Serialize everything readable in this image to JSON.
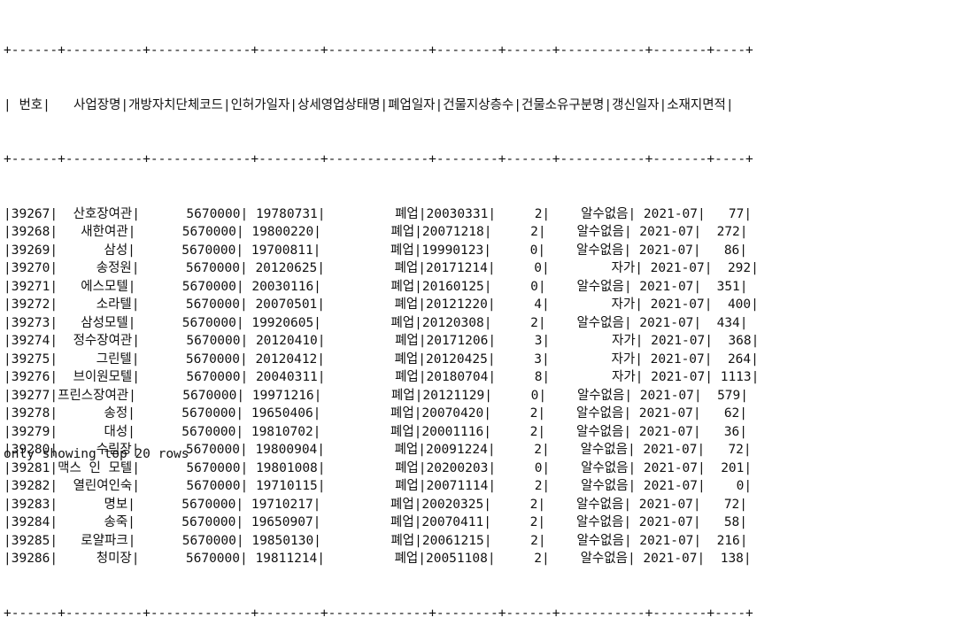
{
  "table": {
    "border": "+------+----------+-------------+--------+-------------+--------+------+-----------+-------+----+",
    "header": "| 번호|   사업장명|개방자치단체코드|인허가일자|상세영업상태명|폐업일자|건물지상층수|건물소유구분명|갱신일자|소재지면적|",
    "header_separator": "+------+----------+-------------+--------+-------------+--------+------+-----------+-------+----+",
    "rows": [
      "|39267|  산호장여관|      5670000| 19780731|         폐업|20030331|     2|    알수없음| 2021-07|   77|",
      "|39268|   새한여관|      5670000| 19800220|         폐업|20071218|     2|    알수없음| 2021-07|  272|",
      "|39269|      삼성|      5670000| 19700811|         폐업|19990123|     0|    알수없음| 2021-07|   86|",
      "|39270|     송정원|      5670000| 20120625|         폐업|20171214|     0|        자가| 2021-07|  292|",
      "|39271|   에스모텔|      5670000| 20030116|         폐업|20160125|     0|    알수없음| 2021-07|  351|",
      "|39272|     소라텔|      5670000| 20070501|         폐업|20121220|     4|        자가| 2021-07|  400|",
      "|39273|   삼성모텔|      5670000| 19920605|         폐업|20120308|     2|    알수없음| 2021-07|  434|",
      "|39274|  정수장여관|      5670000| 20120410|         폐업|20171206|     3|        자가| 2021-07|  368|",
      "|39275|     그린텔|      5670000| 20120412|         폐업|20120425|     3|        자가| 2021-07|  264|",
      "|39276|  브이원모텔|      5670000| 20040311|         폐업|20180704|     8|        자가| 2021-07| 1113|",
      "|39277|프린스장여관|      5670000| 19971216|         폐업|20121129|     0|    알수없음| 2021-07|  579|",
      "|39278|      송정|      5670000| 19650406|         폐업|20070420|     2|    알수없음| 2021-07|   62|",
      "|39279|      대성|      5670000| 19810702|         폐업|20001116|     2|    알수없음| 2021-07|   36|",
      "|39280|     수림장|      5670000| 19800904|         폐업|20091224|     2|    알수없음| 2021-07|   72|",
      "|39281|맥스 인 모텔|      5670000| 19801008|         폐업|20200203|     0|    알수없음| 2021-07|  201|",
      "|39282|  열린여인숙|      5670000| 19710115|         폐업|20071114|     2|    알수없음| 2021-07|    0|",
      "|39283|      명보|      5670000| 19710217|         폐업|20020325|     2|    알수없음| 2021-07|   72|",
      "|39284|      송죽|      5670000| 19650907|         폐업|20070411|     2|    알수없음| 2021-07|   58|",
      "|39285|   로얄파크|      5670000| 19850130|         폐업|20061215|     2|    알수없음| 2021-07|  216|",
      "|39286|     청미장|      5670000| 19811214|         폐업|20051108|     2|    알수없음| 2021-07|  138|"
    ],
    "bottom_border": "+------+----------+-------------+--------+-------------+--------+------+-----------+-------+----+"
  },
  "footer": "only showing top 20 rows"
}
